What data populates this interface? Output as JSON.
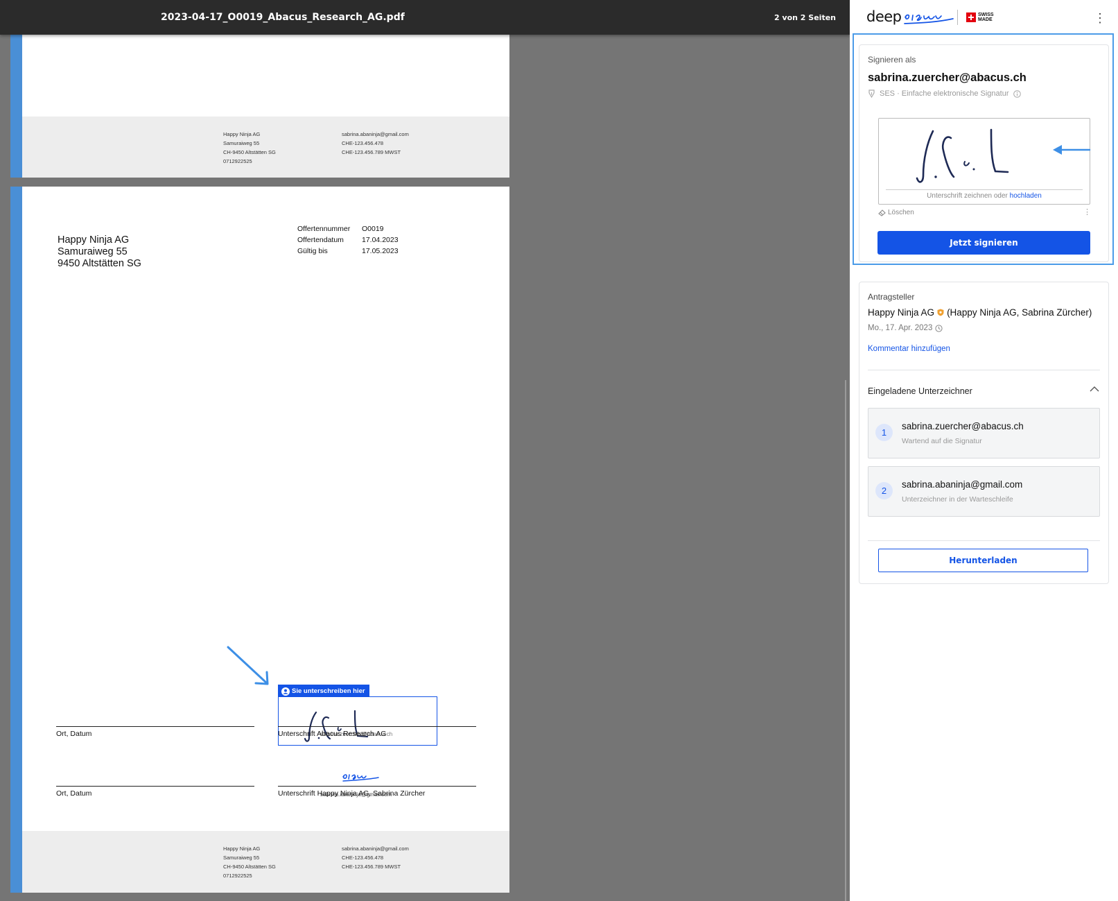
{
  "viewer": {
    "document_title": "2023-04-17_O0019_Abacus_Research_AG.pdf",
    "page_counter": "2 von 2 Seiten"
  },
  "document": {
    "footer": {
      "left": [
        "Happy Ninja AG",
        "Samuraiweg 55",
        "CH-9450 Altstätten SG",
        "0712922525"
      ],
      "right": [
        "sabrina.abaninja@gmail.com",
        "CHE-123.456.478",
        "CHE-123.456.789 MWST"
      ]
    },
    "address": [
      "Happy Ninja AG",
      "Samuraiweg 55",
      "9450 Altstätten SG"
    ],
    "meta": [
      {
        "label": "Offertennummer",
        "value": "O0019"
      },
      {
        "label": "Offertendatum",
        "value": "17.04.2023"
      },
      {
        "label": "Gültig bis",
        "value": "17.05.2023"
      }
    ],
    "place_date_label": "Ort, Datum",
    "sig_label_1": "Unterschrift Abacus Research AG",
    "sig_label_2": "Unterschrift Happy Ninja AG, Sabrina Zürcher",
    "sign_here_badge": "Sie unterschreiben hier",
    "sign_here_email": "sabrina.zuercher@abacus.ch",
    "signer2_email": "sabrina.abaninja@gmail.com"
  },
  "sidebar": {
    "logo_text": "deep",
    "swiss_made": [
      "SWISS",
      "MADE"
    ],
    "sign_card": {
      "label": "Signieren als",
      "email": "sabrina.zuercher@abacus.ch",
      "signature_type": "SES · Einfache elektronische Signatur",
      "pad_hint_text": "Unterschrift zeichnen oder",
      "upload_link": "hochladen",
      "clear_label": "Löschen",
      "sign_button": "Jetzt signieren"
    },
    "info_card": {
      "requester_label": "Antragsteller",
      "requester_org": "Happy Ninja AG",
      "requester_detail": "(Happy Ninja AG, Sabrina Zürcher)",
      "requester_date": "Mo., 17. Apr. 2023",
      "add_comment": "Kommentar hinzufügen",
      "invited_title": "Eingeladene Unterzeichner",
      "signers": [
        {
          "number": "1",
          "email": "sabrina.zuercher@abacus.ch",
          "status": "Wartend auf die Signatur"
        },
        {
          "number": "2",
          "email": "sabrina.abaninja@gmail.com",
          "status": "Unterzeichner in der Warteschleife"
        }
      ],
      "download_button": "Herunterladen"
    }
  },
  "colors": {
    "accent": "#1454e6",
    "highlight_outline": "#4b9be8",
    "viewer_background": "#757575",
    "topbar": "#2b2b2b",
    "page_stripe": "#4a8fd6",
    "shield": "#f0a030"
  }
}
